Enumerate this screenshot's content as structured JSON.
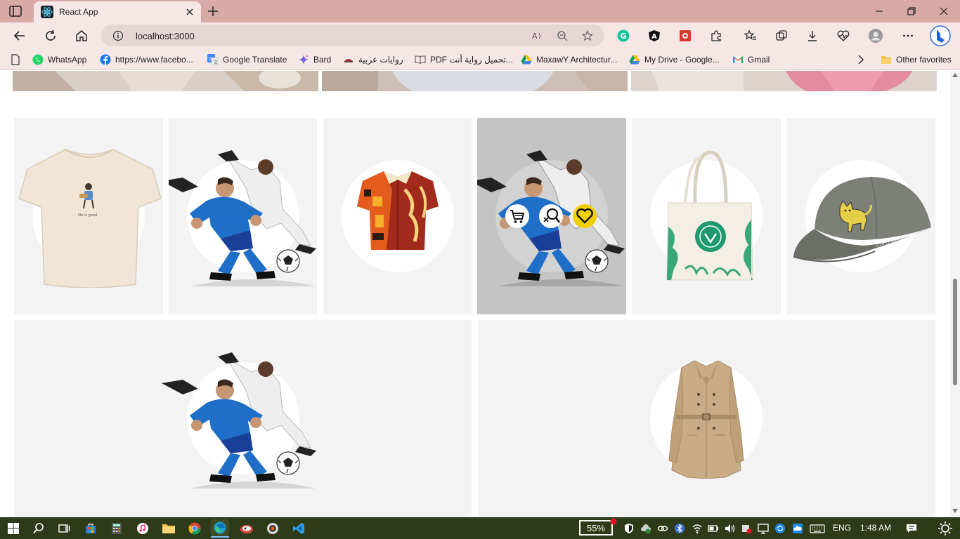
{
  "browser": {
    "tab_title": "React App",
    "url": "localhost:3000"
  },
  "bookmarks": [
    {
      "label": "WhatsApp",
      "icon": "whatsapp-icon"
    },
    {
      "label": "https://www.facebo...",
      "icon": "facebook-icon"
    },
    {
      "label": "Google Translate",
      "icon": "google-translate-icon"
    },
    {
      "label": "Bard",
      "icon": "bard-icon"
    },
    {
      "label": "روايات عربية",
      "icon": "book-site-icon"
    },
    {
      "label": "PDF تحميل رواية أنت...",
      "icon": "book-open-icon"
    },
    {
      "label": "MaxawY Architectur...",
      "icon": "google-drive-icon"
    },
    {
      "label": "My Drive - Google...",
      "icon": "google-drive-icon"
    },
    {
      "label": "Gmail",
      "icon": "gmail-icon"
    }
  ],
  "other_favorites": "Other favorites",
  "products": {
    "row1": [
      "t-shirt-image",
      "football-players-image",
      "patterned-shirt-image",
      "football-players-image",
      "tote-bag-image",
      "cap-image"
    ],
    "row2": [
      "football-players-image",
      "trench-coat-image"
    ]
  },
  "card_actions": [
    "add-to-cart",
    "quick-view",
    "add-to-wishlist"
  ],
  "taskbar": {
    "battery": "55%",
    "language": "ENG",
    "time": "1:48 AM"
  },
  "colors": {
    "titlebar": "#d9a9a6",
    "toolbar": "#f4e7e6",
    "card_bg": "#f3f3f3",
    "card_hover_bg": "#c4c4c4",
    "wishlist": "#f2d000",
    "taskbar": "#2f3b18"
  }
}
